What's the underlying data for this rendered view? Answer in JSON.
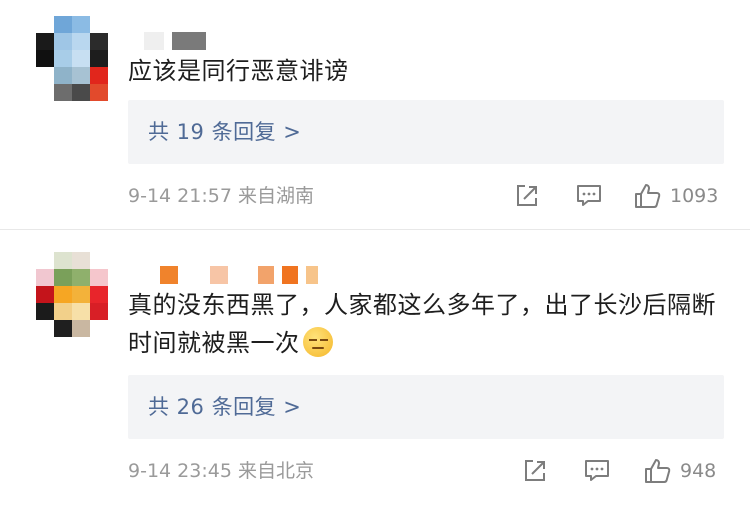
{
  "comments": [
    {
      "text": "应该是同行恶意诽谤",
      "replies_label": "共 19 条回复 >",
      "timestamp": "9-14 21:57 来自湖南",
      "like_count": "1093"
    },
    {
      "text": "真的没东西黑了，人家都这么多年了，出了长沙后隔断时间就被黑一次",
      "emoji": "grimace-emoji",
      "replies_label": "共 26 条回复 >",
      "timestamp": "9-14 23:45 来自北京",
      "like_count": "948"
    }
  ],
  "icons": {
    "share": "share-icon",
    "comment": "comment-icon",
    "like": "thumbs-up-icon"
  },
  "colors": {
    "link": "#4f6a96",
    "meta": "#9a9a9a",
    "reply_bg": "#f3f4f6"
  }
}
